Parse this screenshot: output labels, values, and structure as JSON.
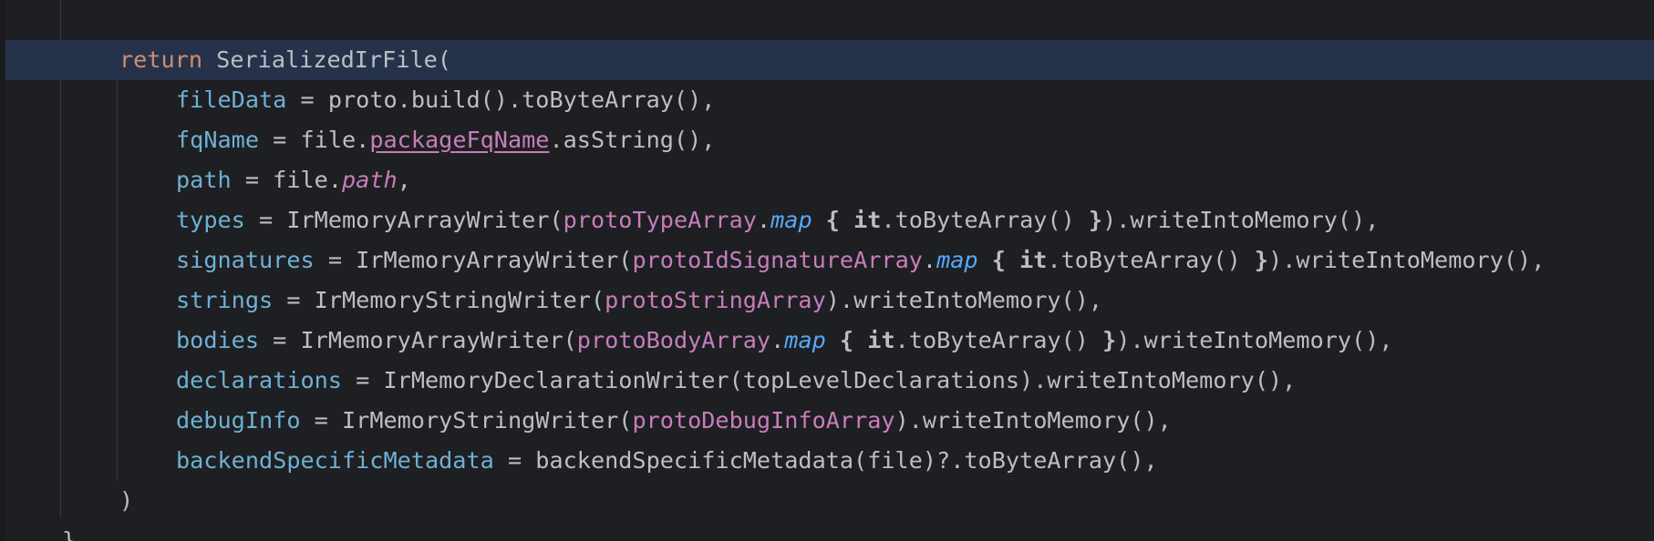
{
  "editor": {
    "language": "Kotlin",
    "theme": {
      "background": "#1e1f22",
      "current_line": "#26324a",
      "keyword": "#cf8e6d",
      "named_argument": "#6fb0d4",
      "property": "#c77dbb",
      "function_literal": "#56a8f5",
      "default_text": "#bcbec4"
    },
    "lines": [
      {
        "t": [
          "return",
          " SerializedIrFile("
        ]
      },
      {
        "t": [
          "fileData",
          " = ",
          "proto.build().toByteArray(),"
        ]
      },
      {
        "t": [
          "fqName",
          " = ",
          "file.",
          "packageFqName",
          ".asString(),"
        ]
      },
      {
        "t": [
          "path",
          " = ",
          "file.",
          "path",
          ","
        ]
      },
      {
        "t": [
          "types",
          " = ",
          "IrMemoryArrayWriter(",
          "protoTypeArray",
          ".",
          "map",
          " ",
          "{",
          " ",
          "it",
          ".toByteArray() ",
          "}",
          ").writeIntoMemory(),"
        ]
      },
      {
        "t": [
          "signatures",
          " = ",
          "IrMemoryArrayWriter(",
          "protoIdSignatureArray",
          ".",
          "map",
          " ",
          "{",
          " ",
          "it",
          ".toByteArray() ",
          "}",
          ").writeIntoMemory(),"
        ]
      },
      {
        "t": [
          "strings",
          " = ",
          "IrMemoryStringWriter(",
          "protoStringArray",
          ").writeIntoMemory(),"
        ]
      },
      {
        "t": [
          "bodies",
          " = ",
          "IrMemoryArrayWriter(",
          "protoBodyArray",
          ".",
          "map",
          " ",
          "{",
          " ",
          "it",
          ".toByteArray() ",
          "}",
          ").writeIntoMemory(),"
        ]
      },
      {
        "t": [
          "declarations",
          " = ",
          "IrMemoryDeclarationWriter(topLevelDeclarations).writeIntoMemory(),"
        ]
      },
      {
        "t": [
          "debugInfo",
          " = ",
          "IrMemoryStringWriter(",
          "protoDebugInfoArray",
          ").writeIntoMemory(),"
        ]
      },
      {
        "t": [
          "backendSpecificMetadata",
          " = ",
          "backendSpecificMetadata(file)?.toByteArray(),"
        ]
      },
      {
        "t": [
          ")"
        ]
      },
      {
        "t": [
          "}"
        ]
      }
    ]
  }
}
